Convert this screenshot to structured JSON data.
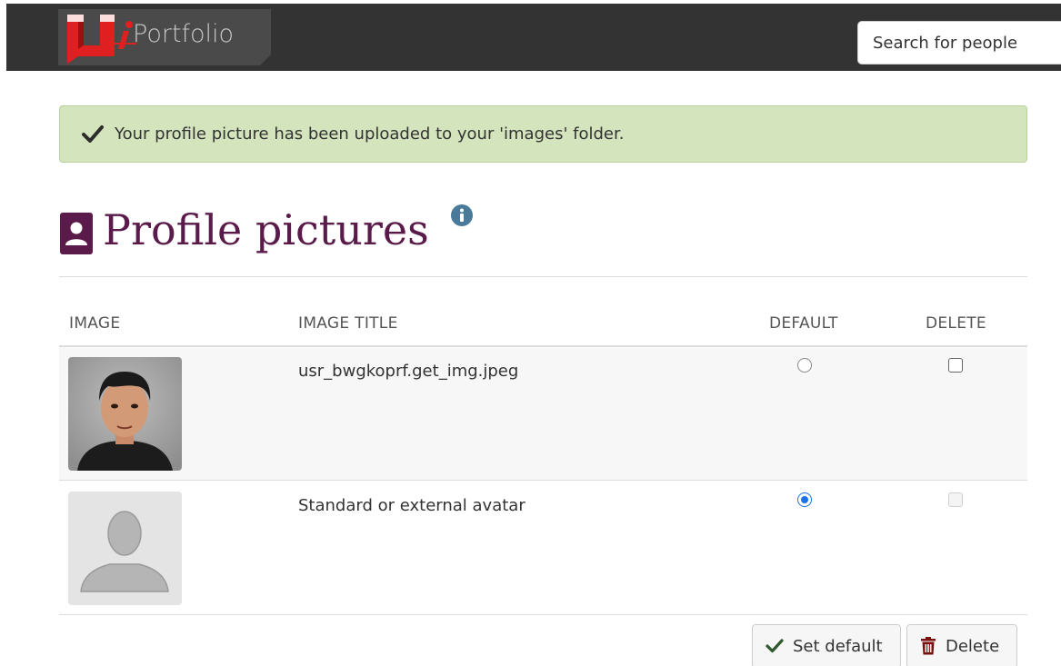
{
  "header": {
    "logo_text": "Portfolio",
    "search_placeholder": "Search for people"
  },
  "alert": {
    "message": "Your profile picture has been uploaded to your 'images' folder."
  },
  "page": {
    "title": "Profile pictures"
  },
  "table": {
    "headers": {
      "image": "IMAGE",
      "image_title": "IMAGE TITLE",
      "default": "DEFAULT",
      "delete": "DELETE"
    },
    "rows": [
      {
        "title": "usr_bwgkoprf.get_img.jpeg",
        "default": false,
        "delete_enabled": true
      },
      {
        "title": "Standard or external avatar",
        "default": true,
        "delete_enabled": false
      }
    ]
  },
  "actions": {
    "set_default_label": "Set default",
    "delete_label": "Delete"
  },
  "colors": {
    "header_bg": "#333333",
    "alert_bg": "#d4e4bc",
    "title_color": "#5a1a4a",
    "radio_selected": "#1a73e8",
    "logo_red": "#d32f2f"
  }
}
